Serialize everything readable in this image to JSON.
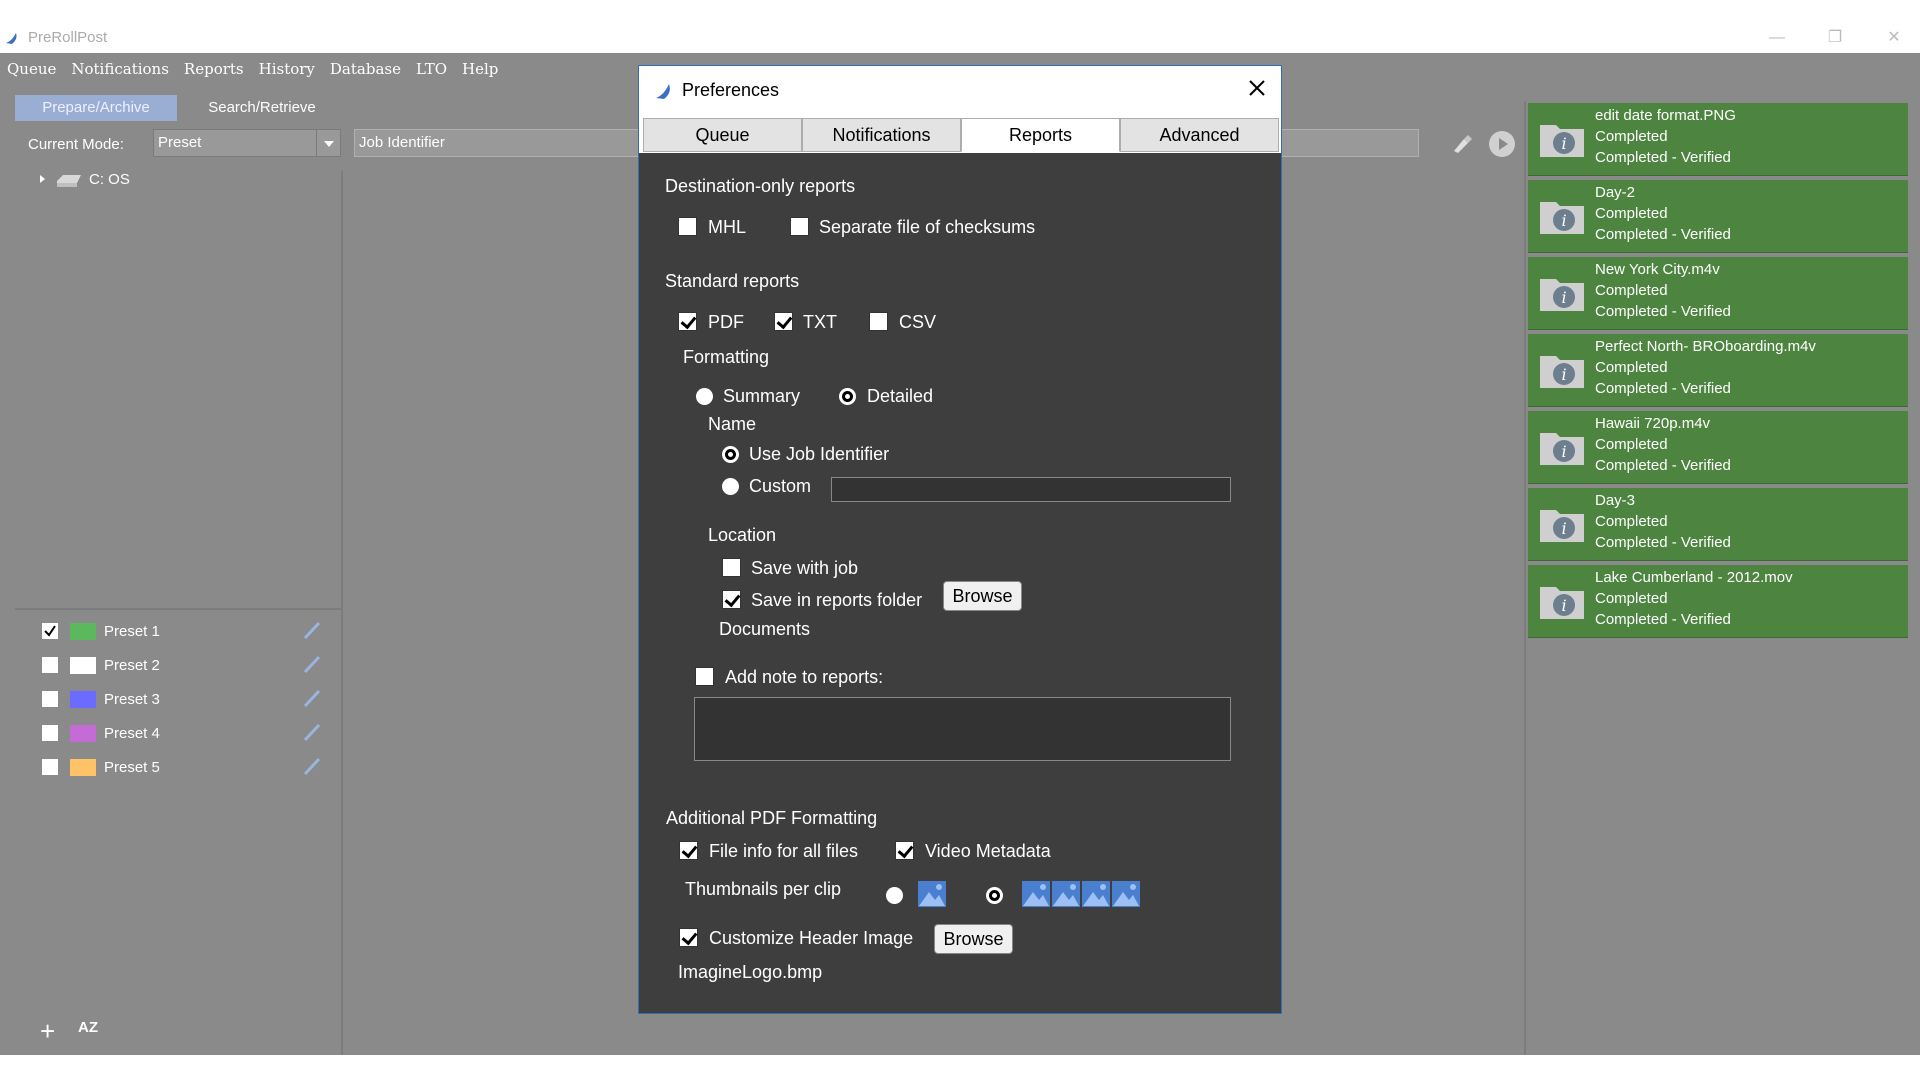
{
  "window": {
    "title": "PreRollPost"
  },
  "menu": [
    "Queue",
    "Notifications",
    "Reports",
    "History",
    "Database",
    "LTO",
    "Help"
  ],
  "mode_tabs": {
    "prepare": "Prepare/Archive",
    "search": "Search/Retrieve"
  },
  "mode": {
    "label": "Current Mode:",
    "value": "Preset"
  },
  "job_identifier_placeholder": "Job Identifier",
  "tree": {
    "drive": "C: OS"
  },
  "presets": [
    {
      "name": "Preset 1",
      "checked": true,
      "color": "#5cb85c"
    },
    {
      "name": "Preset 2",
      "checked": false,
      "color": "#ffffff"
    },
    {
      "name": "Preset 3",
      "checked": false,
      "color": "#6b6bff"
    },
    {
      "name": "Preset 4",
      "checked": false,
      "color": "#c46bd6"
    },
    {
      "name": "Preset 5",
      "checked": false,
      "color": "#ffc266"
    }
  ],
  "bottom": {
    "sort_label": "AZ"
  },
  "queue": [
    {
      "name": "edit date format.PNG",
      "status": "Completed",
      "verify": "Completed - Verified"
    },
    {
      "name": "Day-2",
      "status": "Completed",
      "verify": "Completed - Verified"
    },
    {
      "name": "New York City.m4v",
      "status": "Completed",
      "verify": "Completed - Verified"
    },
    {
      "name": "Perfect North- BROboarding.m4v",
      "status": "Completed",
      "verify": "Completed - Verified"
    },
    {
      "name": "Hawaii 720p.m4v",
      "status": "Completed",
      "verify": "Completed - Verified"
    },
    {
      "name": "Day-3",
      "status": "Completed",
      "verify": "Completed - Verified"
    },
    {
      "name": "Lake Cumberland - 2012.mov",
      "status": "Completed",
      "verify": "Completed - Verified"
    }
  ],
  "dialog": {
    "title": "Preferences",
    "tabs": [
      "Queue",
      "Notifications",
      "Reports",
      "Advanced"
    ],
    "active_tab": "Reports",
    "destination_only": {
      "heading": "Destination-only reports",
      "mhl": "MHL",
      "separate": "Separate file of checksums"
    },
    "standard": {
      "heading": "Standard reports",
      "pdf": "PDF",
      "txt": "TXT",
      "csv": "CSV"
    },
    "formatting": {
      "heading": "Formatting",
      "summary": "Summary",
      "detailed": "Detailed"
    },
    "name": {
      "heading": "Name",
      "use_job": "Use Job Identifier",
      "custom": "Custom",
      "custom_value": ""
    },
    "location": {
      "heading": "Location",
      "save_with_job": "Save with job",
      "save_in_folder": "Save in reports folder",
      "browse": "Browse",
      "folder_path": "Documents"
    },
    "note": {
      "label": "Add note to reports:",
      "value": ""
    },
    "pdf_formatting": {
      "heading": "Additional PDF Formatting",
      "file_info": "File info for all files",
      "video_metadata": "Video Metadata",
      "thumbnails": "Thumbnails per clip",
      "customize_header": "Customize Header Image",
      "browse": "Browse",
      "header_file": "ImagineLogo.bmp"
    }
  }
}
